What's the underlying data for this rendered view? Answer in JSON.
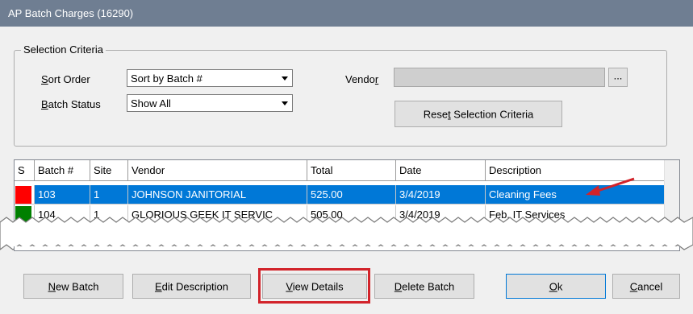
{
  "window": {
    "title": "AP Batch Charges (16290)"
  },
  "selection_criteria": {
    "group_label": "Selection Criteria",
    "sort_order": {
      "label_pre": "",
      "label_ul": "S",
      "label_post": "ort Order",
      "value": "Sort by Batch #"
    },
    "batch_status": {
      "label_pre": "",
      "label_ul": "B",
      "label_post": "atch Status",
      "value": "Show All"
    },
    "vendor": {
      "label_pre": "Vendo",
      "label_ul": "r",
      "label_post": "",
      "value": ""
    },
    "browse_label": "...",
    "reset": {
      "pre": "Rese",
      "ul": "t",
      "post": " Selection Criteria"
    }
  },
  "grid": {
    "columns": [
      "S",
      "Batch #",
      "Site",
      "Vendor",
      "Total",
      "Date",
      "Description"
    ],
    "rows": [
      {
        "status_color": "#ff0000",
        "batch": "103",
        "site": "1",
        "vendor": "JOHNSON JANITORIAL",
        "total": "525.00",
        "date": "3/4/2019",
        "description": "Cleaning Fees",
        "selected": true
      },
      {
        "status_color": "#008000",
        "batch": "104",
        "site": "1",
        "vendor": "GLORIOUS GEEK IT SERVIC",
        "total": "505.00",
        "date": "3/4/2019",
        "description": "Feb. IT Services",
        "selected": false
      }
    ]
  },
  "buttons": {
    "new_batch": {
      "pre": "",
      "ul": "N",
      "post": "ew Batch"
    },
    "edit_description": {
      "pre": "",
      "ul": "E",
      "post": "dit Description"
    },
    "view_details": {
      "pre": "",
      "ul": "V",
      "post": "iew Details"
    },
    "delete_batch": {
      "pre": "",
      "ul": "D",
      "post": "elete Batch"
    },
    "ok": {
      "pre": "",
      "ul": "O",
      "post": "k"
    },
    "cancel": {
      "pre": "",
      "ul": "C",
      "post": "ancel"
    }
  },
  "colors": {
    "titlebar": "#6f7e92",
    "selection": "#0078d7",
    "highlight_border": "#d2232a",
    "arrow": "#d2232a"
  }
}
